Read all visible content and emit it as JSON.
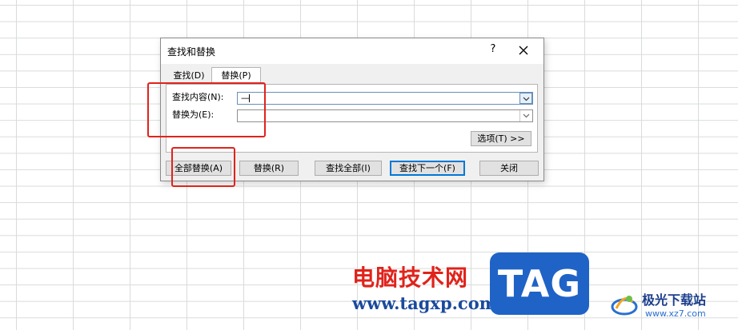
{
  "dialog": {
    "title": "查找和替换",
    "help_label": "?",
    "tabs": [
      {
        "label": "查找(D)",
        "selected": false
      },
      {
        "label": "替换(P)",
        "selected": true
      }
    ],
    "find_label": "查找内容(N):",
    "find_value": "—",
    "replace_label": "替换为(E):",
    "replace_value": "",
    "options_button": "选项(T) >>",
    "buttons": {
      "replace_all": "全部替换(A)",
      "replace": "替换(R)",
      "find_all": "查找全部(I)",
      "find_next": "查找下一个(F)",
      "close": "关闭"
    }
  },
  "colors": {
    "highlight_box": "#e0231b",
    "default_button_border": "#0078d7",
    "grid_line": "#d8dcd9"
  },
  "watermark": {
    "site_cn": "电脑技术网",
    "site_url": "www.tagxp.com",
    "tag": "TAG",
    "brand_cn": "极光下载站",
    "brand_url": "www.xz7.com"
  }
}
